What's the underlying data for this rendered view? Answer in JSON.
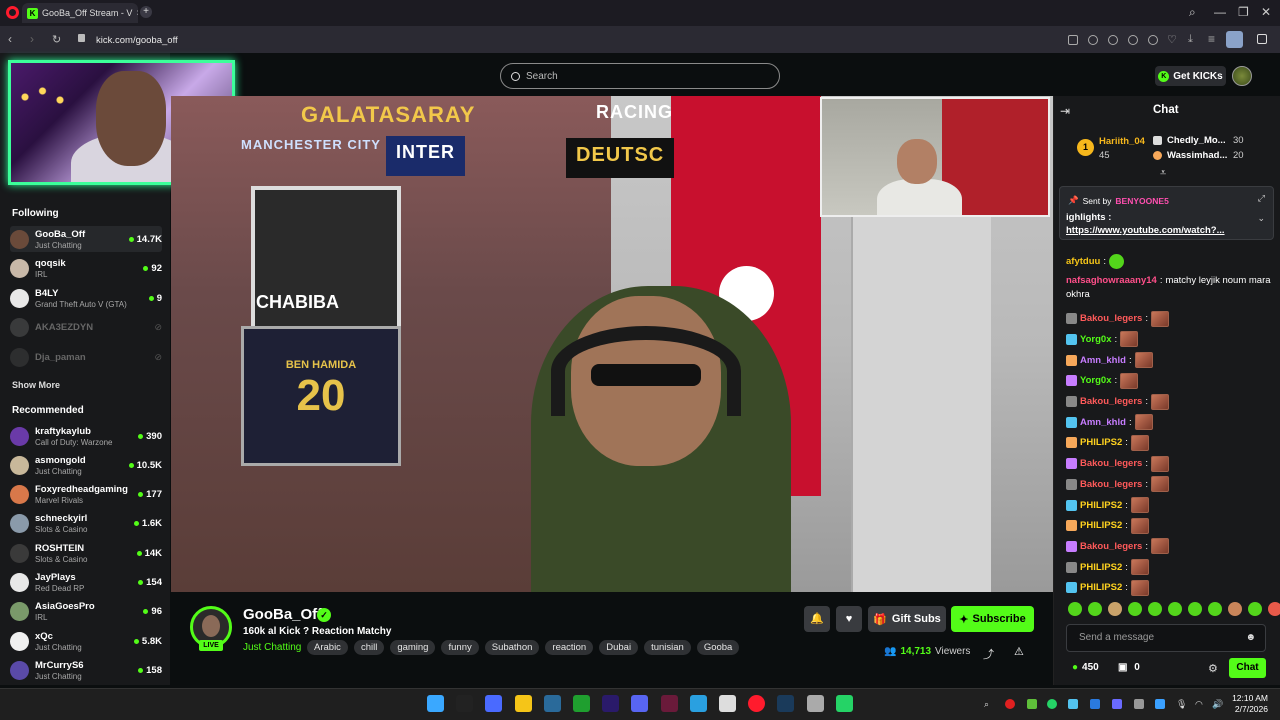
{
  "browser": {
    "tab_title": "GooBa_Off Stream - V",
    "url": "kick.com/gooba_off",
    "new_tab": "+",
    "close_tab": "×",
    "win_min": "—",
    "win_max": "❐",
    "win_close": "✕",
    "search_glyph": "⌕"
  },
  "header": {
    "search_placeholder": "Search",
    "get_kicks": "Get KICKs"
  },
  "sidebar": {
    "following_title": "Following",
    "following": [
      {
        "name": "GooBa_Off",
        "category": "Just Chatting",
        "viewers": "14.7K",
        "live": true,
        "color": "#6a4a3a"
      },
      {
        "name": "qoqsik",
        "category": "IRL",
        "viewers": "92",
        "live": true,
        "color": "#c8b8a8"
      },
      {
        "name": "B4LY",
        "category": "Grand Theft Auto V (GTA)",
        "viewers": "9",
        "live": true,
        "color": "#e8e8e8"
      },
      {
        "name": "AKA3EZDYN",
        "category": "",
        "viewers": "",
        "live": false,
        "color": "#777"
      },
      {
        "name": "Dja_paman",
        "category": "",
        "viewers": "",
        "live": false,
        "color": "#555"
      }
    ],
    "show_more": "Show More",
    "recommended_title": "Recommended",
    "recommended": [
      {
        "name": "kraftykaylub",
        "category": "Call of Duty: Warzone",
        "viewers": "390",
        "color": "#6a3aa8"
      },
      {
        "name": "asmongold",
        "category": "Just Chatting",
        "viewers": "10.5K",
        "color": "#c8b89a"
      },
      {
        "name": "Foxyredheadgaming",
        "category": "Marvel Rivals",
        "viewers": "177",
        "color": "#d8784a"
      },
      {
        "name": "schneckyirl",
        "category": "Slots & Casino",
        "viewers": "1.6K",
        "color": "#8a9aaa"
      },
      {
        "name": "ROSHTEIN",
        "category": "Slots & Casino",
        "viewers": "14K",
        "color": "#3a3a3a"
      },
      {
        "name": "JayPlays",
        "category": "Red Dead RP",
        "viewers": "154",
        "color": "#e8e8e8"
      },
      {
        "name": "AsiaGoesPro",
        "category": "IRL",
        "viewers": "96",
        "color": "#7a9a6a"
      },
      {
        "name": "xQc",
        "category": "Just Chatting",
        "viewers": "5.8K",
        "color": "#f0f0f0"
      },
      {
        "name": "MrCurryS6",
        "category": "Just Chatting",
        "viewers": "158",
        "color": "#5a4aa8"
      }
    ]
  },
  "video_overlay": {
    "banner1": "GALATASARAY",
    "banner2": "RACING",
    "banner3": "MANCHESTER CITY",
    "banner4": "INTER",
    "banner5": "DEUTSC",
    "chabiba": "CHABIBA",
    "jersey_name": "BEN HAMIDA",
    "jersey_number": "20"
  },
  "stream": {
    "streamer": "GooBa_Off",
    "live_label": "LIVE",
    "verified": "✓",
    "title": "160k al Kick ? Reaction Matchy",
    "category": "Just Chatting",
    "tags": [
      "Arabic",
      "chill",
      "gaming",
      "funny",
      "Subathon",
      "reaction",
      "Dubai",
      "tunisian",
      "Gooba"
    ],
    "gift_subs": "Gift Subs",
    "subscribe": "Subscribe",
    "viewers": "14,713",
    "viewers_label": "Viewers",
    "bell": "🔔",
    "heart": "♥",
    "share": "⤴",
    "report": "⚠"
  },
  "chat": {
    "title": "Chat",
    "leaderboard": [
      {
        "rank": "1",
        "name": "Hariith_04",
        "count": "45"
      },
      {
        "name": "Chedly_Mo...",
        "count": "30"
      },
      {
        "name": "Wassimhad...",
        "count": "20"
      }
    ],
    "pinned": {
      "sent_by": "Sent by",
      "sender": "BENYOONE5",
      "line1": "ighlights :",
      "link": "https://www.youtube.com/watch?..."
    },
    "messages": [
      {
        "user": "afytduu",
        "color": "#f5c518",
        "text": "",
        "emote": "green"
      },
      {
        "user": "nafsaghowraaany14",
        "color": "#ff4f8a",
        "text": "matchy leyjik noum mara",
        "text2": "okhra"
      },
      {
        "user": "Bakou_legers",
        "color": "#ff5a5a",
        "emote": "face"
      },
      {
        "user": "Yorg0x",
        "color": "#53fc18",
        "emote": "face"
      },
      {
        "user": "Amn_khld",
        "color": "#c77dff",
        "emote": "face"
      },
      {
        "user": "Yorg0x",
        "color": "#53fc18",
        "emote": "face"
      },
      {
        "user": "Bakou_legers",
        "color": "#ff5a5a",
        "emote": "face"
      },
      {
        "user": "Amn_khld",
        "color": "#c77dff",
        "emote": "face"
      },
      {
        "user": "PHILIPS2",
        "color": "#ffd21f",
        "emote": "face"
      },
      {
        "user": "Bakou_legers",
        "color": "#ff5a5a",
        "emote": "face"
      },
      {
        "user": "Bakou_legers",
        "color": "#ff5a5a",
        "emote": "face"
      },
      {
        "user": "PHILIPS2",
        "color": "#ffd21f",
        "emote": "face"
      },
      {
        "user": "PHILIPS2",
        "color": "#ffd21f",
        "emote": "face"
      },
      {
        "user": "Bakou_legers",
        "color": "#ff5a5a",
        "emote": "face"
      },
      {
        "user": "PHILIPS2",
        "color": "#ffd21f",
        "emote": "face"
      },
      {
        "user": "PHILIPS2",
        "color": "#ffd21f",
        "emote": "face"
      }
    ],
    "input_placeholder": "Send a message",
    "kicks": "450",
    "gifts": "0",
    "send": "Chat"
  },
  "taskbar": {
    "time": "12:10 AM",
    "date": "2/7/2026"
  },
  "colors": {
    "accent": "#53fc18",
    "background": "#0b0e0f",
    "panel": "#18191b"
  }
}
